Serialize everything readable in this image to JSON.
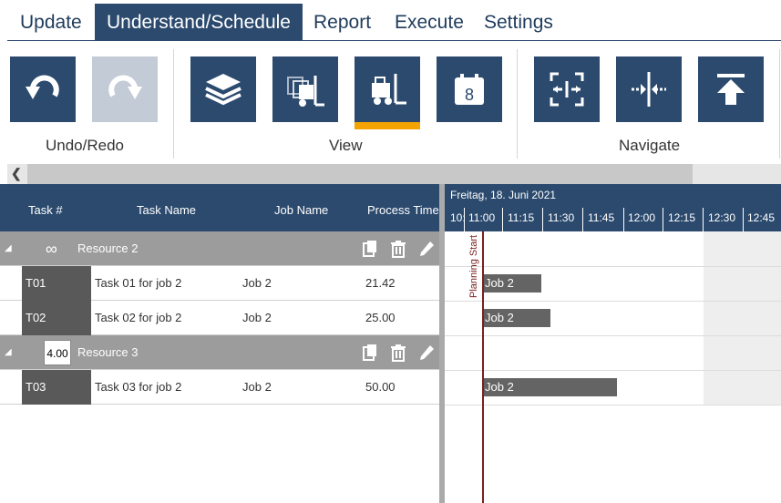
{
  "menu": {
    "tabs": [
      "Update",
      "Understand/Schedule",
      "Report",
      "Execute",
      "Settings"
    ],
    "active": "Understand/Schedule"
  },
  "toolbar": {
    "groups": [
      "Undo/Redo",
      "View",
      "Navigate"
    ],
    "calendar_day": "8"
  },
  "grid": {
    "columns": [
      "Task #",
      "Task Name",
      "Job Name",
      "Process Time"
    ],
    "resource2": {
      "label": "Resource 2",
      "capacity_symbol": "∞"
    },
    "resource3": {
      "label": "Resource 3",
      "capacity": "4.00"
    },
    "tasks": [
      {
        "id": "T01",
        "name": "Task 01 for job 2",
        "job": "Job 2",
        "time": "21.42"
      },
      {
        "id": "T02",
        "name": "Task 02 for job 2",
        "job": "Job 2",
        "time": "25.00"
      },
      {
        "id": "T03",
        "name": "Task 03 for job 2",
        "job": "Job 2",
        "time": "50.00"
      }
    ]
  },
  "gantt": {
    "date": "Freitag, 18. Juni 2021",
    "ticks": [
      "10:",
      "11:00",
      "11:15",
      "11:30",
      "11:45",
      "12:00",
      "12:15",
      "12:30",
      "12:45"
    ],
    "planning_start": "Planning Start",
    "bars": [
      "Job 2",
      "Job 2",
      "Job 2"
    ]
  },
  "colors": {
    "primary": "#2b4a6e",
    "accent": "#f4a300",
    "group_row": "#9c9c9c",
    "task_cell": "#595959",
    "plan_line": "#7a1f1f"
  }
}
